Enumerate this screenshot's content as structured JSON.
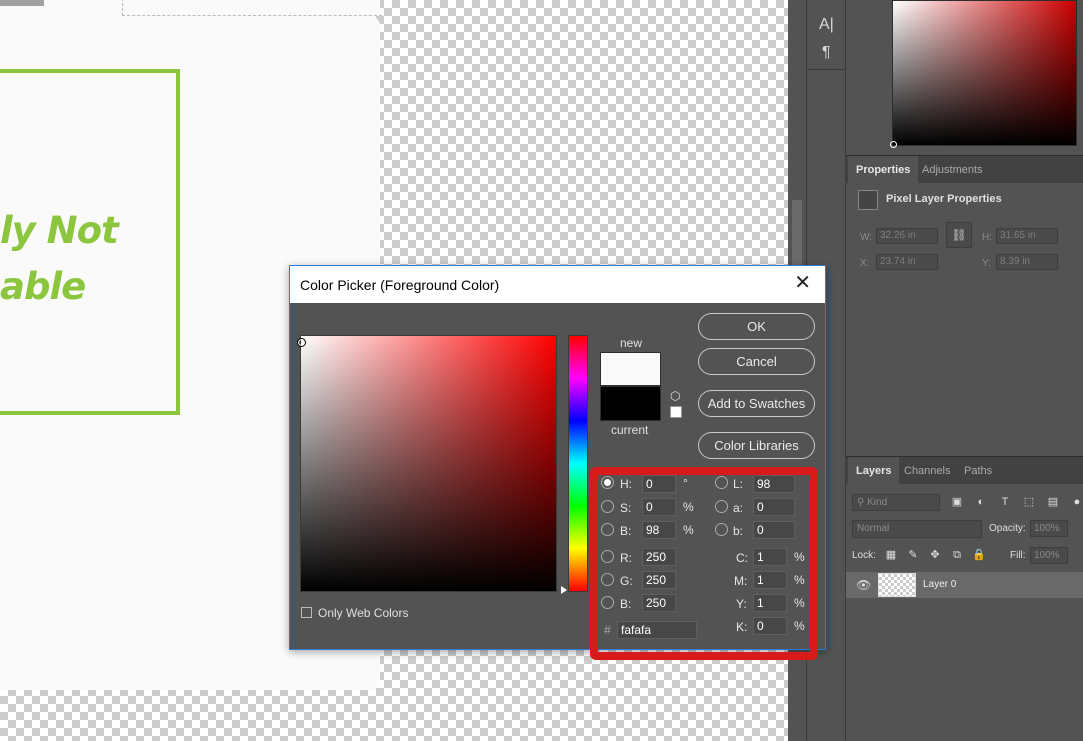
{
  "canvas": {
    "headline_line1": "ly Not",
    "headline_line2": "able",
    "accent_color": "#8cc63f",
    "doc_background": "#fafafa"
  },
  "toolstrip": {
    "items": [
      {
        "icon": "character-panel-icon",
        "glyph": "A|"
      },
      {
        "icon": "paragraph-panel-icon",
        "glyph": "¶"
      }
    ]
  },
  "properties_panel": {
    "tabs": [
      "Properties",
      "Adjustments"
    ],
    "active_tab": "Properties",
    "title": "Pixel Layer Properties",
    "w_label": "W:",
    "w_value": "32.26 in",
    "h_label": "H:",
    "h_value": "31.65 in",
    "x_label": "X:",
    "x_value": "23.74 in",
    "y_label": "Y:",
    "y_value": "8.39 in"
  },
  "layers_panel": {
    "tabs": [
      "Layers",
      "Channels",
      "Paths"
    ],
    "active_tab": "Layers",
    "filter_kind": "Kind",
    "blend_mode": "Normal",
    "opacity_label": "Opacity:",
    "opacity_value": "100%",
    "lock_label": "Lock:",
    "fill_label": "Fill:",
    "fill_value": "100%",
    "layers": [
      {
        "name": "Layer 0",
        "visible": true
      }
    ]
  },
  "dialog": {
    "title": "Color Picker (Foreground Color)",
    "close_glyph": "✕",
    "buttons": {
      "ok": "OK",
      "cancel": "Cancel",
      "add_swatches": "Add to Swatches",
      "color_libraries": "Color Libraries"
    },
    "new_label": "new",
    "current_label": "current",
    "new_color": "#fafafa",
    "current_color": "#000000",
    "only_web_colors": "Only Web Colors",
    "only_web_colors_checked": false,
    "selected_mode": "H",
    "fields": {
      "H": {
        "label": "H:",
        "value": "0",
        "unit": "°"
      },
      "S": {
        "label": "S:",
        "value": "0",
        "unit": "%"
      },
      "Bv": {
        "label": "B:",
        "value": "98",
        "unit": "%"
      },
      "R": {
        "label": "R:",
        "value": "250"
      },
      "G": {
        "label": "G:",
        "value": "250"
      },
      "Bl": {
        "label": "B:",
        "value": "250"
      },
      "L": {
        "label": "L:",
        "value": "98"
      },
      "a": {
        "label": "a:",
        "value": "0"
      },
      "b": {
        "label": "b:",
        "value": "0"
      },
      "C": {
        "label": "C:",
        "value": "1",
        "unit": "%"
      },
      "M": {
        "label": "M:",
        "value": "1",
        "unit": "%"
      },
      "Y": {
        "label": "Y:",
        "value": "1",
        "unit": "%"
      },
      "K": {
        "label": "K:",
        "value": "0",
        "unit": "%"
      }
    },
    "hex_sign": "#",
    "hex_value": "fafafa"
  },
  "annotation": {
    "highlight_color": "#d71a1a"
  }
}
